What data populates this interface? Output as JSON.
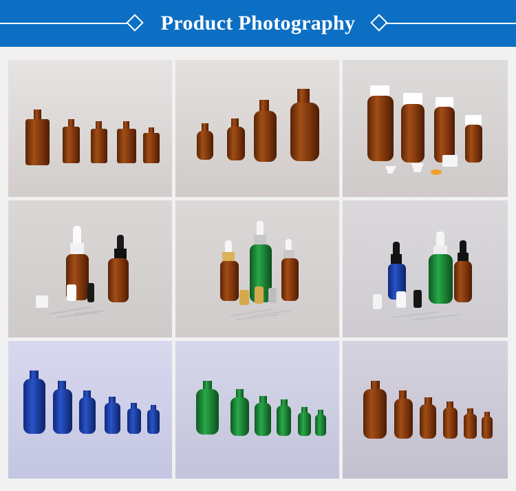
{
  "header": {
    "title": "Product Photography",
    "background": "#0c6fc4",
    "text_color": "#ffffff"
  },
  "photos": [
    {
      "name": "amber-square-bottles",
      "colors": {
        "bg": "#dcd8d6",
        "glass": "#8a3f10"
      }
    },
    {
      "name": "amber-round-bottles",
      "colors": {
        "bg": "#dad5d2",
        "glass": "#8a3a10"
      }
    },
    {
      "name": "amber-bottles-white-caps",
      "colors": {
        "bg": "#d7d3d3",
        "glass": "#8f4413"
      }
    },
    {
      "name": "amber-dropper-bottles",
      "colors": {
        "bg": "#d5d0d1",
        "glass": "#8c3e10"
      }
    },
    {
      "name": "amber-green-dropper-bottles",
      "colors": {
        "bg": "#d7d3d3",
        "glass": "#1b8a37"
      }
    },
    {
      "name": "blue-green-dropper-bottles",
      "colors": {
        "bg": "#d4d2d6",
        "glass": "#1a3fa8"
      }
    },
    {
      "name": "cobalt-blue-bottles",
      "colors": {
        "bg": "#cbcce6",
        "glass": "#1c3db4"
      }
    },
    {
      "name": "green-bottles",
      "colors": {
        "bg": "#cacbdf",
        "glass": "#1a9433"
      }
    },
    {
      "name": "amber-bottles-row",
      "colors": {
        "bg": "#ccc8d6",
        "glass": "#8e4611"
      }
    }
  ]
}
